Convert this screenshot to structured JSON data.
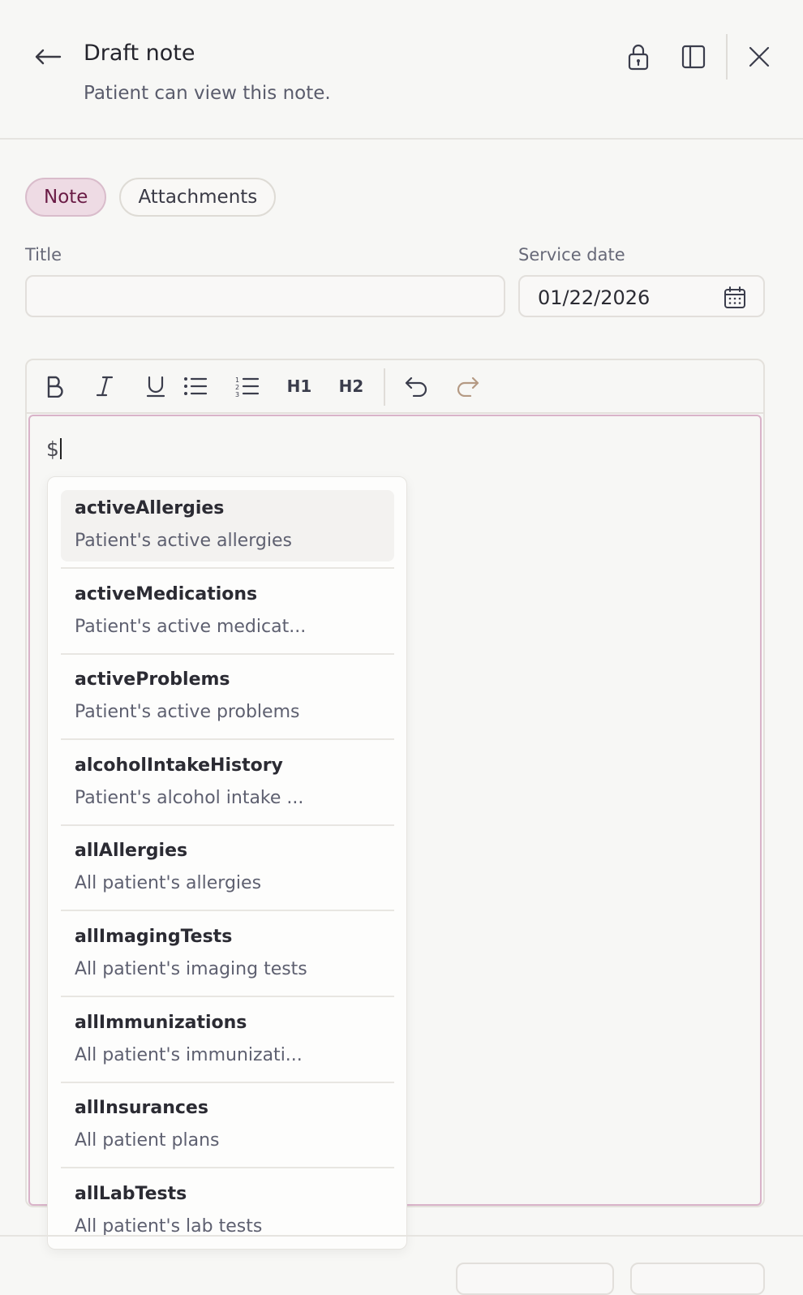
{
  "header": {
    "title": "Draft note",
    "subtitle": "Patient can view this note.",
    "icons": [
      "back-arrow-icon",
      "lock-icon",
      "sidebar-panel-icon",
      "close-icon"
    ]
  },
  "tabs": [
    {
      "label": "Note",
      "active": true
    },
    {
      "label": "Attachments",
      "active": false
    }
  ],
  "form": {
    "title_label": "Title",
    "title_value": "",
    "service_date_label": "Service date",
    "service_date_value": "01/22/2026"
  },
  "toolbar": {
    "buttons": [
      "bold",
      "italic",
      "underline",
      "bullet-list",
      "numbered-list",
      "heading-1",
      "heading-2",
      "undo",
      "redo"
    ],
    "h1_label": "H1",
    "h2_label": "H2"
  },
  "editor": {
    "content": "$"
  },
  "suggestions": [
    {
      "name": "activeAllergies",
      "desc": "Patient's active allergies",
      "highlighted": true
    },
    {
      "name": "activeMedications",
      "desc": "Patient's active medicat..."
    },
    {
      "name": "activeProblems",
      "desc": "Patient's active problems"
    },
    {
      "name": "alcoholIntakeHistory",
      "desc": "Patient's alcohol intake ..."
    },
    {
      "name": "allAllergies",
      "desc": "All patient's allergies"
    },
    {
      "name": "allImagingTests",
      "desc": "All patient's imaging tests"
    },
    {
      "name": "allImmunizations",
      "desc": "All patient's immunizati..."
    },
    {
      "name": "allInsurances",
      "desc": "All patient plans"
    },
    {
      "name": "allLabTests",
      "desc": "All patient's lab tests"
    }
  ],
  "colors": {
    "accent": "#6a1b45",
    "accent_bg": "#eedbe4",
    "editor_focus_border": "#d9b3c9"
  }
}
